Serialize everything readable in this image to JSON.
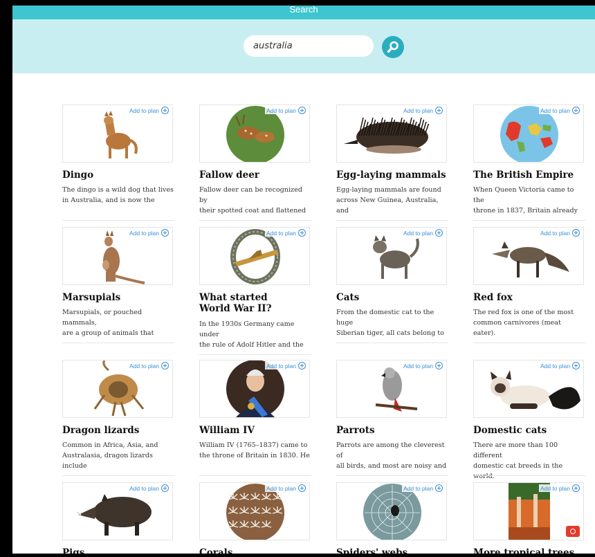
{
  "header": {
    "title": "Search"
  },
  "search": {
    "value": "australia"
  },
  "cards": [
    {
      "title": "Dingo",
      "desc": [
        "The dingo is a wild dog that lives",
        "in Australia, and is now the"
      ],
      "add_label": "Add to plan",
      "icon": "dingo-image"
    },
    {
      "title": "Fallow deer",
      "desc": [
        "Fallow deer can be recognized by",
        "their spotted coat and flattened"
      ],
      "add_label": "Add to plan",
      "icon": "fallow-deer-image"
    },
    {
      "title": "Egg-laying mammals",
      "desc": [
        "Egg-laying mammals are found",
        "across New Guinea, Australia, and"
      ],
      "add_label": "Add to plan",
      "icon": "echidna-image"
    },
    {
      "title": "The British Empire",
      "desc": [
        "When Queen Victoria came to the",
        "throne in 1837, Britain already"
      ],
      "add_label": "Add to plan",
      "icon": "world-map-image"
    },
    {
      "title": "Marsupials",
      "desc": [
        "Marsupials, or pouched mammals,",
        "are a group of animals that"
      ],
      "add_label": "Add to plan",
      "icon": "kangaroo-image"
    },
    {
      "title": "What started World War II?",
      "desc": [
        "In the 1930s Germany came under",
        "the rule of Adolf Hitler and the"
      ],
      "add_label": "Add to plan",
      "icon": "badge-image"
    },
    {
      "title": "Cats",
      "desc": [
        "From the domestic cat to the huge",
        "Siberian tiger, all cats belong to"
      ],
      "add_label": "Add to plan",
      "icon": "cat-image"
    },
    {
      "title": "Red fox",
      "desc": [
        "The red fox is one of the most",
        "common carnivores (meat eater)."
      ],
      "add_label": "Add to plan",
      "icon": "fox-image"
    },
    {
      "title": "Dragon lizards",
      "desc": [
        "Common in Africa, Asia, and",
        "Australasia, dragon lizards include"
      ],
      "add_label": "Add to plan",
      "icon": "lizard-image"
    },
    {
      "title": "William IV",
      "desc": [
        "William IV (1765–1837) came to",
        "the throne of Britain in 1830. He"
      ],
      "add_label": "Add to plan",
      "icon": "portrait-image"
    },
    {
      "title": "Parrots",
      "desc": [
        "Parrots are among the cleverest of",
        "all birds, and most are noisy and"
      ],
      "add_label": "Add to plan",
      "icon": "parrot-image"
    },
    {
      "title": "Domestic cats",
      "desc": [
        "There are more than 100 different",
        "domestic cat breeds in the world."
      ],
      "add_label": "Add to plan",
      "icon": "siamese-cat-image"
    },
    {
      "title": "Pigs",
      "desc": [],
      "add_label": "Add to plan",
      "icon": "boar-image"
    },
    {
      "title": "Corals",
      "desc": [],
      "add_label": "Add to plan",
      "icon": "coral-image"
    },
    {
      "title": "Spiders' webs",
      "desc": [],
      "add_label": "Add to plan",
      "icon": "spider-web-image"
    },
    {
      "title": "More tropical trees",
      "desc": [],
      "add_label": "Add to plan",
      "icon": "tree-photo-image",
      "badge_icon": "camera-icon"
    }
  ]
}
